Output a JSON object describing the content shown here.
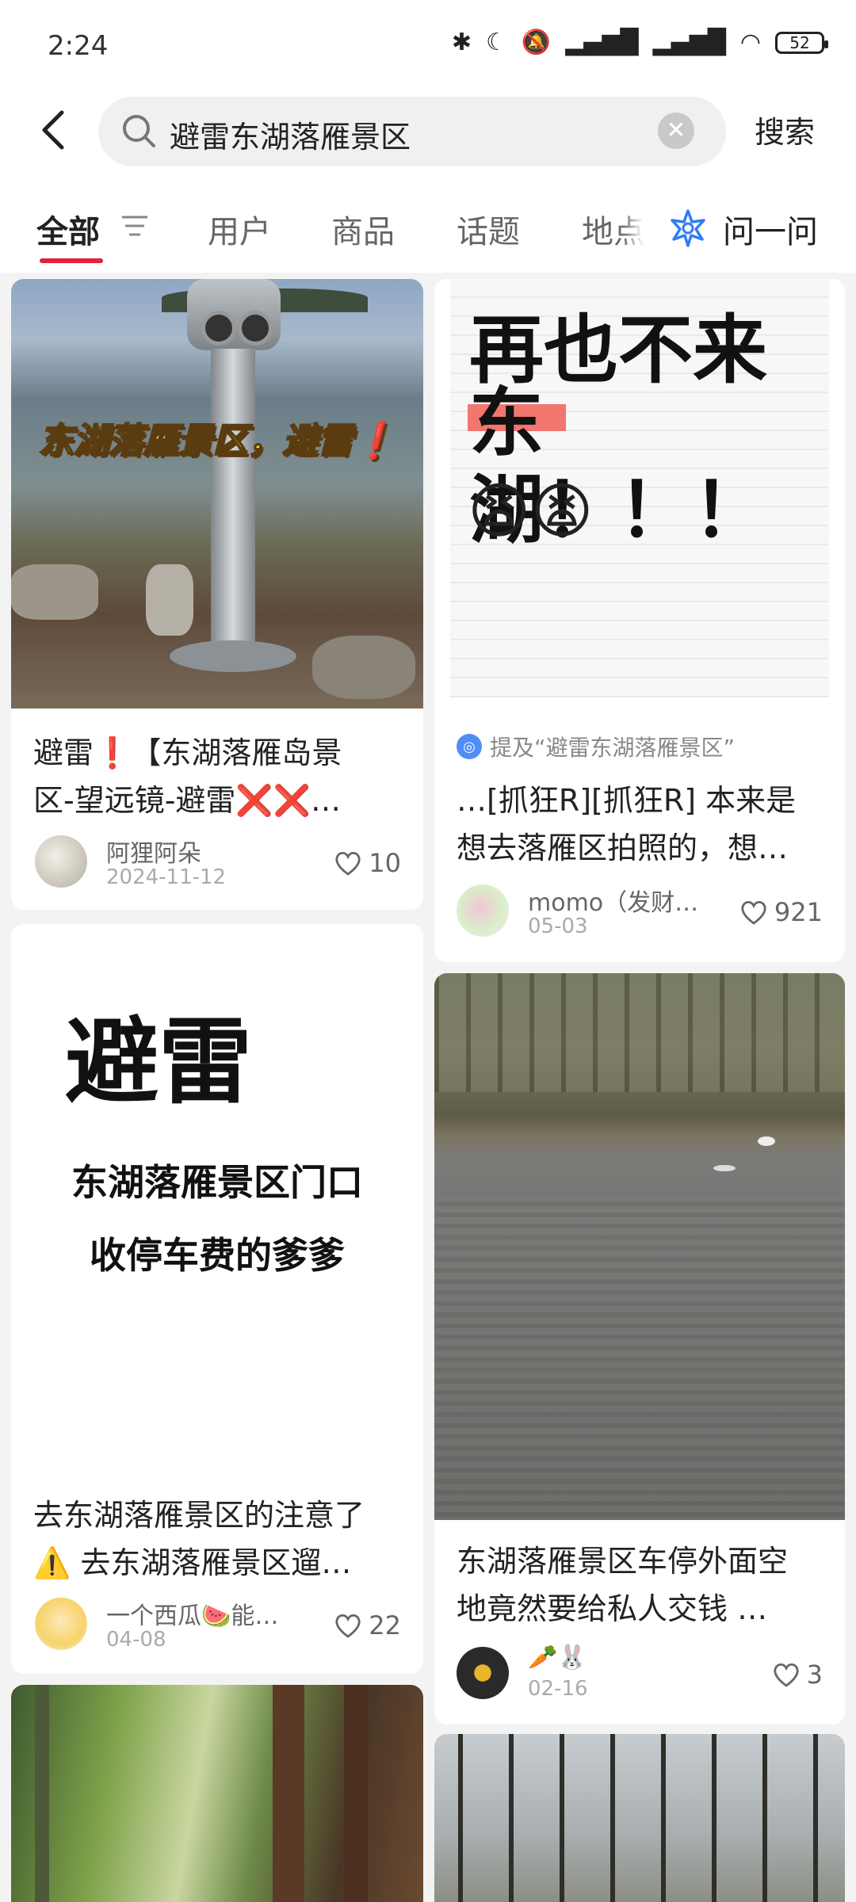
{
  "status": {
    "time": "2:24",
    "battery": "52"
  },
  "search": {
    "query": "避雷东湖落雁景区",
    "button": "搜索"
  },
  "tabs": [
    "全部",
    "用户",
    "商品",
    "话题",
    "地点"
  ],
  "ask": "问一问",
  "cards": [
    {
      "image_caption": "东湖落雁景区，避雷",
      "image_mark": "❗",
      "title_line1": "避雷❗【东湖落雁岛景",
      "title_line2": "区-望远镜-避雷❌❌…",
      "author": "阿狸阿朵",
      "date": "2024-11-12",
      "likes": "10"
    },
    {
      "image_line1": "再也不来",
      "image_line2": "东湖！！！",
      "image_emoji": "😫😫",
      "mention": "提及“避雷东湖落雁景区”",
      "title_line1": "…[抓狂R][抓狂R] 本来是",
      "title_line2": "想去落雁区拍照的，想…",
      "author": "momo（发财…",
      "date": "05-03",
      "likes": "921"
    },
    {
      "image_big": "避雷",
      "image_line1": "东湖落雁景区门口",
      "image_line2": "收停车费的爹爹",
      "title_line1": "去东湖落雁景区的注意了",
      "title_line2": "⚠️ 去东湖落雁景区遛…",
      "author": "一个西瓜🍉能…",
      "date": "04-08",
      "likes": "22"
    },
    {
      "title_line1": "东湖落雁景区车停外面空",
      "title_line2": "地竟然要给私人交钱 …",
      "author": "🥕🐰",
      "date": "02-16",
      "likes": "3"
    }
  ],
  "colors": {
    "accent": "#e2233b",
    "ask_icon": "#2f7cf6"
  }
}
